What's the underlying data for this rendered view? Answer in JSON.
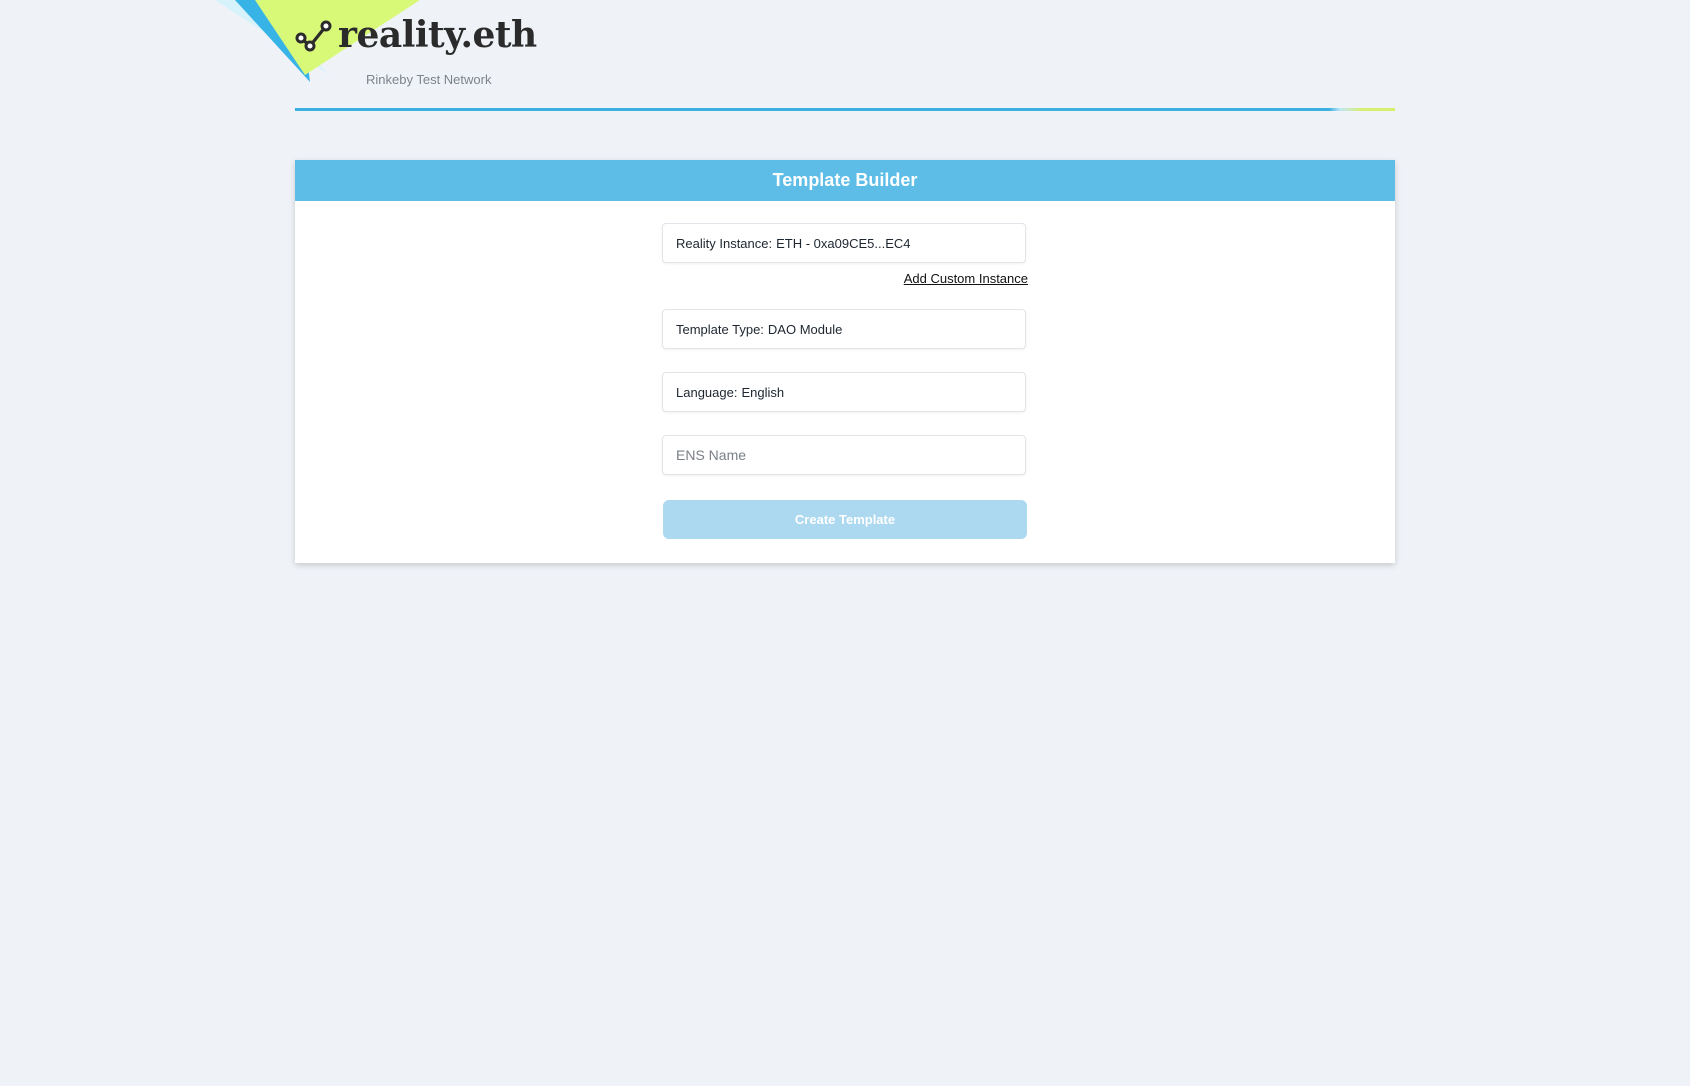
{
  "brand": {
    "name": "reality.eth",
    "network": "Rinkeby Test Network",
    "logo_icon": "node-graph-icon",
    "colors": {
      "accent": "#5dbde7",
      "highlight": "#d8f070",
      "background": "#eff3f8"
    }
  },
  "panel": {
    "title": "Template Builder"
  },
  "form": {
    "reality_instance": {
      "label": "Reality Instance:",
      "value": "ETH - 0xa09CE5...EC4"
    },
    "add_custom_instance_label": "Add Custom Instance",
    "template_type": {
      "label": "Template Type:",
      "value": "DAO Module"
    },
    "language": {
      "label": "Language:",
      "value": "English"
    },
    "ens_name": {
      "placeholder": "ENS Name",
      "value": ""
    },
    "create_button_label": "Create Template"
  }
}
